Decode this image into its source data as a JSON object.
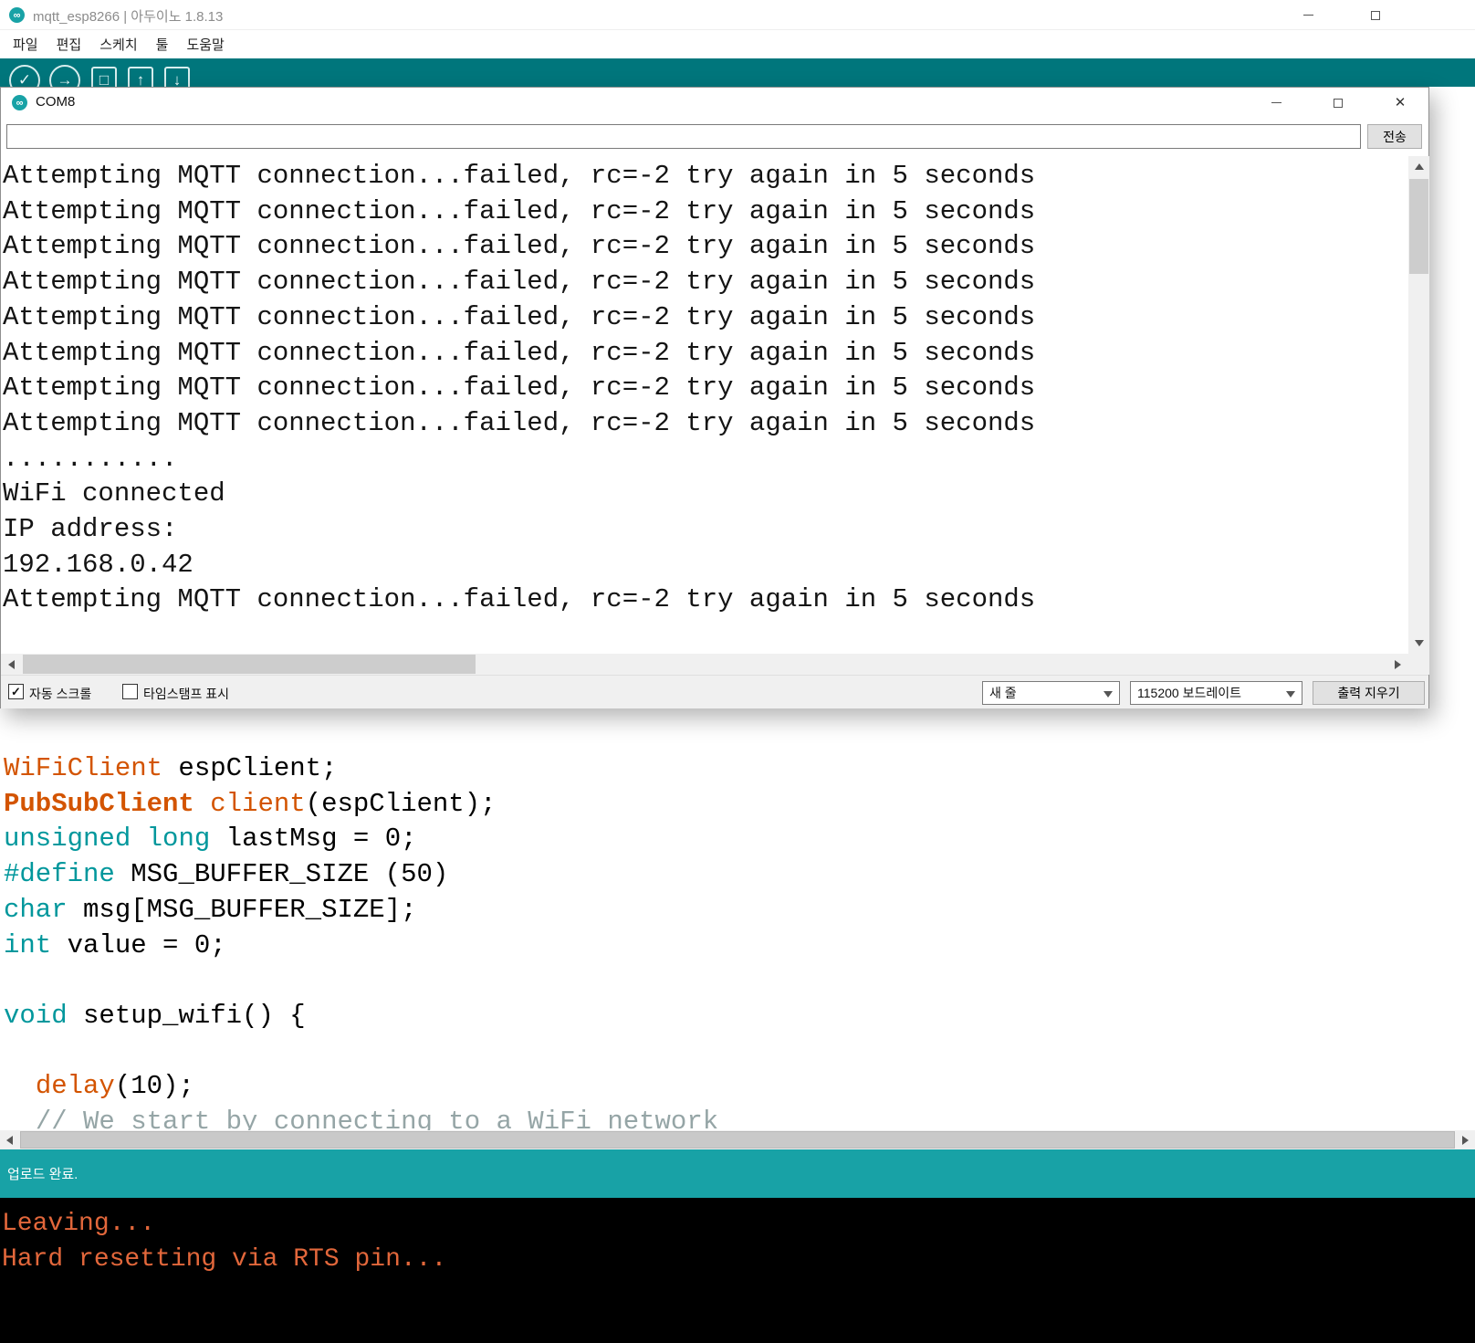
{
  "ide": {
    "window_title": "mqtt_esp8266 | 아두이노 1.8.13",
    "menu": [
      "파일",
      "편집",
      "스케치",
      "툴",
      "도움말"
    ],
    "status_text": "업로드 완료.",
    "console_lines": [
      "Leaving...",
      "Hard resetting via RTS pin..."
    ],
    "code_lines": [
      [
        {
          "t": "WiFiClient",
          "c": "cls"
        },
        {
          "t": " espClient;",
          "c": "pln"
        }
      ],
      [
        {
          "t": "PubSubClient",
          "c": "clsb"
        },
        {
          "t": " ",
          "c": "pln"
        },
        {
          "t": "client",
          "c": "cls"
        },
        {
          "t": "(espClient);",
          "c": "pln"
        }
      ],
      [
        {
          "t": "unsigned",
          "c": "typ"
        },
        {
          "t": " ",
          "c": "pln"
        },
        {
          "t": "long",
          "c": "typ"
        },
        {
          "t": " lastMsg = 0;",
          "c": "pln"
        }
      ],
      [
        {
          "t": "#define",
          "c": "typ"
        },
        {
          "t": " MSG_BUFFER_SIZE (50)",
          "c": "pln"
        }
      ],
      [
        {
          "t": "char",
          "c": "typ"
        },
        {
          "t": " msg[MSG_BUFFER_SIZE];",
          "c": "pln"
        }
      ],
      [
        {
          "t": "int",
          "c": "typ"
        },
        {
          "t": " value = 0;",
          "c": "pln"
        }
      ],
      [],
      [
        {
          "t": "void",
          "c": "typ"
        },
        {
          "t": " setup_wifi() {",
          "c": "pln"
        }
      ],
      [],
      [
        {
          "t": "  ",
          "c": "pln"
        },
        {
          "t": "delay",
          "c": "fn"
        },
        {
          "t": "(10);",
          "c": "pln"
        }
      ],
      [
        {
          "t": "  ",
          "c": "pln"
        },
        {
          "t": "// We start by connecting to a WiFi network",
          "c": "cmt"
        }
      ]
    ]
  },
  "serial_monitor": {
    "window_title": "COM8",
    "input_value": "",
    "send_button": "전송",
    "output_lines": [
      "Attempting MQTT connection...failed, rc=-2 try again in 5 seconds",
      "Attempting MQTT connection...failed, rc=-2 try again in 5 seconds",
      "Attempting MQTT connection...failed, rc=-2 try again in 5 seconds",
      "Attempting MQTT connection...failed, rc=-2 try again in 5 seconds",
      "Attempting MQTT connection...failed, rc=-2 try again in 5 seconds",
      "Attempting MQTT connection...failed, rc=-2 try again in 5 seconds",
      "Attempting MQTT connection...failed, rc=-2 try again in 5 seconds",
      "Attempting MQTT connection...failed, rc=-2 try again in 5 seconds",
      "...........",
      "WiFi connected",
      "IP address:",
      "192.168.0.42",
      "Attempting MQTT connection...failed, rc=-2 try again in 5 seconds"
    ],
    "autoscroll": {
      "label": "자동 스크롤",
      "checked": true
    },
    "timestamp": {
      "label": "타임스탬프 표시",
      "checked": false
    },
    "line_ending_select": "새 줄",
    "baud_select": "115200 보드레이트",
    "clear_button": "출력 지우기"
  },
  "colors": {
    "toolbar_teal": "#00767C",
    "status_teal": "#18A2A6",
    "console_bg": "#000000",
    "console_text": "#E2673B",
    "type_color": "#00979C",
    "function_color": "#D35400",
    "class_color": "#D35400",
    "comment_color": "#95A5A6"
  }
}
